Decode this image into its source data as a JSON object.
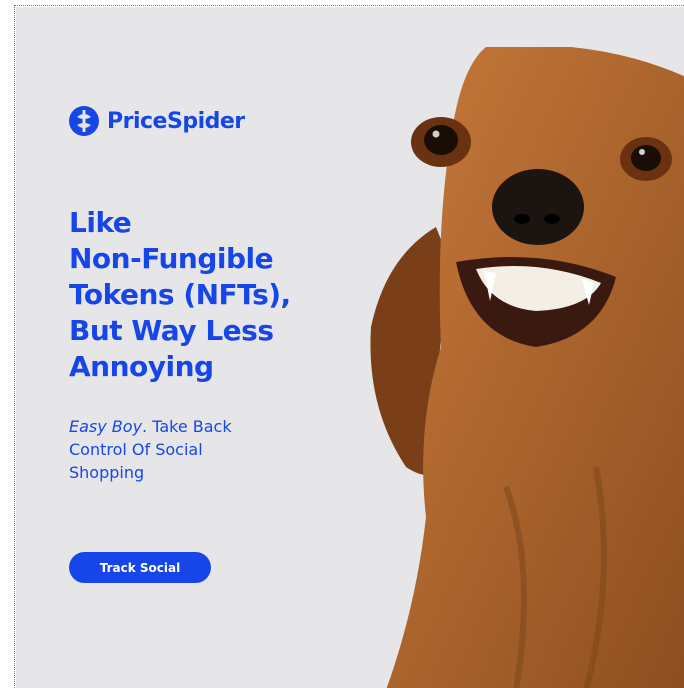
{
  "brand": {
    "name": "PriceSpider",
    "icon": "pricespider-logo-icon",
    "color": "#1746e8"
  },
  "headline": {
    "lines": [
      "Like",
      "Non-Fungible",
      "Tokens (NFTs),",
      "But Way Less",
      "Annoying"
    ]
  },
  "subheadline": {
    "emphasis": "Easy Boy",
    "rest": ". Take Back Control Of Social Shopping"
  },
  "cta": {
    "label": "Track Social"
  },
  "image": {
    "subject": "dog-photo"
  },
  "colors": {
    "background": "#e6e6e8",
    "accent": "#1746e8"
  }
}
